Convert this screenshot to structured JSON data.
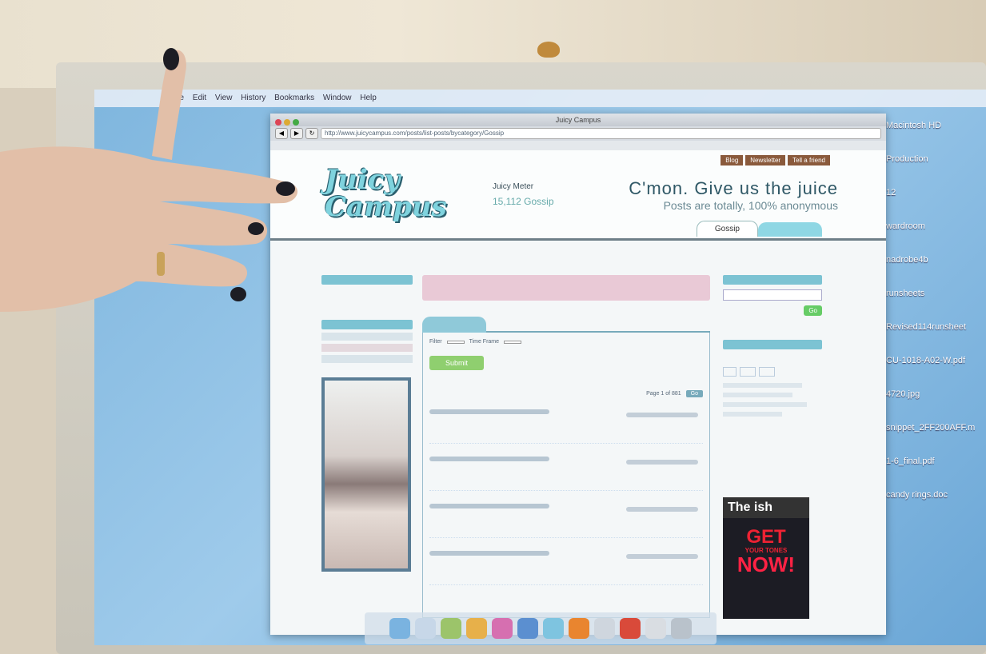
{
  "menubar": {
    "items": [
      "File",
      "Edit",
      "View",
      "History",
      "Bookmarks",
      "Window",
      "Help"
    ]
  },
  "browser": {
    "window_title": "Juicy Campus",
    "url": "http://www.juicycampus.com/posts/list-posts/bycategory/Gossip"
  },
  "site": {
    "logo_text": "Juicy Campus",
    "top_links": [
      "Blog",
      "Newsletter",
      "Tell a friend"
    ],
    "meter_label": "Juicy Meter",
    "meter_value": "15,112 Gossip",
    "tagline_1": "C'mon. Give us the juice",
    "tagline_2": "Posts are totally, 100% anonymous",
    "active_tab": "Gossip",
    "filter_label": "Filter",
    "time_frame_label": "Time Frame",
    "green_button": "Submit",
    "paging_text": "Page 1 of 881",
    "go_label": "Go"
  },
  "desktop": {
    "items": [
      "Macintosh HD",
      "Production",
      "12",
      "wardroom",
      "nadrobe4b",
      "runsheets",
      "Revised114runsheet",
      "CU-1018-A02-W.pdf",
      "4720.jpg",
      "snippet_2FF200AFF.m",
      "1-6_final.pdf",
      "candy rings.doc"
    ]
  },
  "ad": {
    "brand": "The ish",
    "line1": "GET",
    "line2": "YOUR TONES",
    "line3": "NOW!"
  },
  "colors": {
    "accent": "#7cc3d3",
    "logo": "#7fd3de",
    "header_rule": "#6e7f88"
  }
}
